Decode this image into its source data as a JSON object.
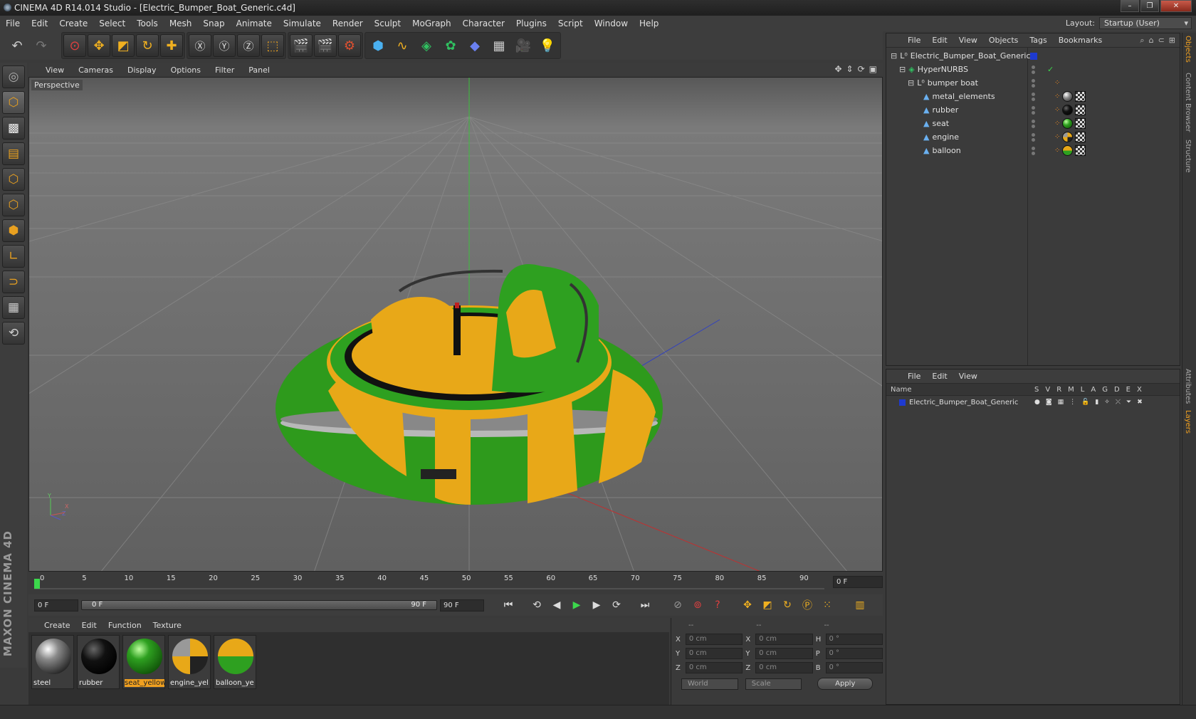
{
  "window": {
    "title": "CINEMA 4D R14.014 Studio - [Electric_Bumper_Boat_Generic.c4d]",
    "controls": [
      "–",
      "❐",
      "✕"
    ]
  },
  "menubar": {
    "items": [
      "File",
      "Edit",
      "Create",
      "Select",
      "Tools",
      "Mesh",
      "Snap",
      "Animate",
      "Simulate",
      "Render",
      "Sculpt",
      "MoGraph",
      "Character",
      "Plugins",
      "Script",
      "Window",
      "Help"
    ],
    "layout_label": "Layout:",
    "layout_value": "Startup (User)"
  },
  "viewport": {
    "menus": [
      "View",
      "Cameras",
      "Display",
      "Options",
      "Filter",
      "Panel"
    ],
    "label": "Perspective",
    "axis_labels": {
      "y": "Y",
      "x": "X",
      "z": "Z"
    }
  },
  "timeline": {
    "ticks": [
      "0",
      "5",
      "10",
      "15",
      "20",
      "25",
      "30",
      "35",
      "40",
      "45",
      "50",
      "55",
      "60",
      "65",
      "70",
      "75",
      "80",
      "85",
      "90"
    ],
    "current_frame": "0 F"
  },
  "playbar": {
    "start_field": "0 F",
    "range_start": "0 F",
    "range_end": "90 F",
    "end_field": "90 F"
  },
  "materials": {
    "menus": [
      "Create",
      "Edit",
      "Function",
      "Texture"
    ],
    "items": [
      {
        "name": "steel",
        "color": "#8a8a8a"
      },
      {
        "name": "rubber",
        "color": "#111111"
      },
      {
        "name": "seat_yellow",
        "color": "#2ea020",
        "selected": true
      },
      {
        "name": "engine_yel",
        "color": "#e8a818"
      },
      {
        "name": "balloon_ye",
        "color": "#e8a818"
      }
    ]
  },
  "coordinates": {
    "headers": [
      "--",
      "--",
      "--"
    ],
    "rows": [
      {
        "a": "X",
        "av": "0 cm",
        "b": "X",
        "bv": "0 cm",
        "c": "H",
        "cv": "0 °"
      },
      {
        "a": "Y",
        "av": "0 cm",
        "b": "Y",
        "bv": "0 cm",
        "c": "P",
        "cv": "0 °"
      },
      {
        "a": "Z",
        "av": "0 cm",
        "b": "Z",
        "bv": "0 cm",
        "c": "B",
        "cv": "0 °"
      }
    ],
    "mode_world": "World",
    "mode_scale": "Scale",
    "apply": "Apply"
  },
  "objects_panel": {
    "menus": [
      "File",
      "Edit",
      "View",
      "Objects",
      "Tags",
      "Bookmarks"
    ],
    "items": [
      {
        "name": "Electric_Bumper_Boat_Generic",
        "type": "null"
      },
      {
        "name": "HyperNURBS",
        "type": "nurbs"
      },
      {
        "name": "bumper boat",
        "type": "null"
      },
      {
        "name": "metal_elements",
        "type": "poly",
        "mat": "#8a8a8a"
      },
      {
        "name": "rubber",
        "type": "poly",
        "mat": "#111111"
      },
      {
        "name": "seat",
        "type": "poly",
        "mat": "#2ea020"
      },
      {
        "name": "engine",
        "type": "poly",
        "mat": "#e8a818"
      },
      {
        "name": "balloon",
        "type": "poly",
        "mat": "#e8a818"
      }
    ]
  },
  "layers_panel": {
    "menus": [
      "File",
      "Edit",
      "View"
    ],
    "header_name": "Name",
    "header_cols": [
      "S",
      "V",
      "R",
      "M",
      "L",
      "A",
      "G",
      "D",
      "E",
      "X"
    ],
    "row_name": "Electric_Bumper_Boat_Generic",
    "row_color": "#1e3ad0"
  },
  "side_tabs": [
    "Objects",
    "Content Browser",
    "Structure",
    "Attributes",
    "Layers"
  ],
  "brand": "MAXON CINEMA 4D"
}
